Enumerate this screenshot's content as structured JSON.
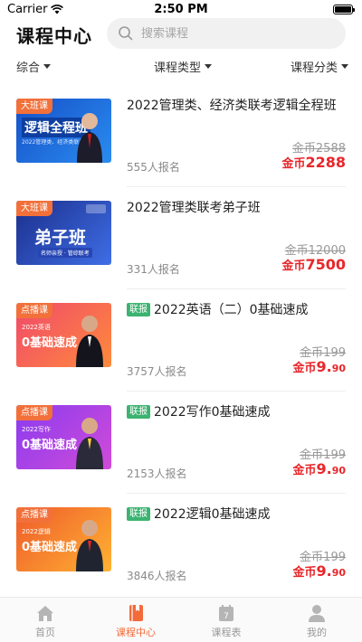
{
  "status_bar": {
    "carrier": "Carrier",
    "time": "2:50 PM"
  },
  "header": {
    "title": "课程中心"
  },
  "search": {
    "placeholder": "搜索课程"
  },
  "filters": [
    {
      "label": "综合"
    },
    {
      "label": "课程类型"
    },
    {
      "label": "课程分类"
    }
  ],
  "courses": [
    {
      "badge": "大班课",
      "thumb_text": "逻辑全程班",
      "thumb_sub": "2022管理类、经济类联考",
      "tag": "",
      "title": "2022管理类、经济类联考逻辑全程班",
      "enroll": "555人报名",
      "orig_price": "金币2588",
      "cur_prefix": "金币",
      "cur_int": "2288",
      "cur_dec": ""
    },
    {
      "badge": "大班课",
      "thumb_text": "弟子班",
      "thumb_sub": "名师亲授 · 管综联考",
      "tag": "",
      "title": "2022管理类联考弟子班",
      "enroll": "331人报名",
      "orig_price": "金币12000",
      "cur_prefix": "金币",
      "cur_int": "7500",
      "cur_dec": ""
    },
    {
      "badge": "点播课",
      "thumb_text": "0基础速成",
      "thumb_sub": "2022英语",
      "tag": "联报",
      "title": "2022英语（二）0基础速成",
      "enroll": "3757人报名",
      "orig_price": "金币199",
      "cur_prefix": "金币",
      "cur_int": "9.",
      "cur_dec": "90"
    },
    {
      "badge": "点播课",
      "thumb_text": "0基础速成",
      "thumb_sub": "2022写作",
      "tag": "联报",
      "title": "2022写作0基础速成",
      "enroll": "2153人报名",
      "orig_price": "金币199",
      "cur_prefix": "金币",
      "cur_int": "9.",
      "cur_dec": "90"
    },
    {
      "badge": "点播课",
      "thumb_text": "0基础速成",
      "thumb_sub": "2022逻辑",
      "tag": "联报",
      "title": "2022逻辑0基础速成",
      "enroll": "3846人报名",
      "orig_price": "金币199",
      "cur_prefix": "金币",
      "cur_int": "9.",
      "cur_dec": "90"
    }
  ],
  "tabs": [
    {
      "label": "首页",
      "icon": "home-icon"
    },
    {
      "label": "课程中心",
      "icon": "book-icon",
      "active": true
    },
    {
      "label": "课程表",
      "icon": "calendar-icon",
      "calendar_day": "7"
    },
    {
      "label": "我的",
      "icon": "person-icon"
    }
  ],
  "colors": {
    "accent": "#f36b3a",
    "price_red": "#e8262a",
    "tag_green": "#3cb371",
    "badge_orange": "#f2703a"
  }
}
